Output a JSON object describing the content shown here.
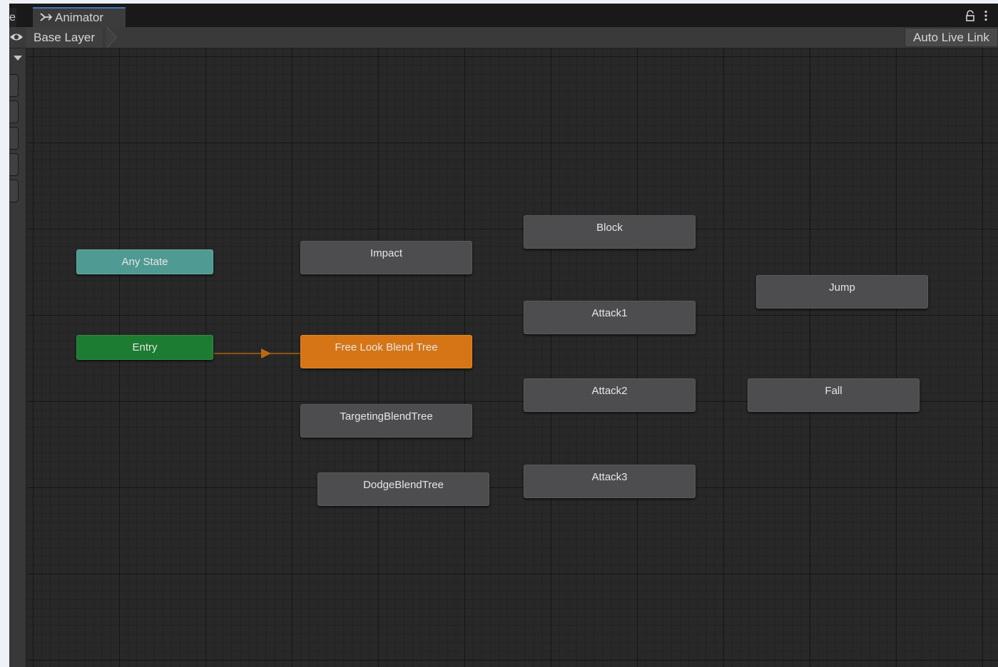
{
  "window": {
    "edge_tab_label": "e",
    "tab_title": "Animator"
  },
  "breadcrumb": {
    "layer": "Base Layer",
    "live_link_label": "Auto Live Link"
  },
  "states": {
    "any_state": "Any State",
    "entry": "Entry",
    "impact": "Impact",
    "free_look": "Free Look Blend Tree",
    "targeting": "TargetingBlendTree",
    "dodge": "DodgeBlendTree",
    "block": "Block",
    "attack1": "Attack1",
    "attack2": "Attack2",
    "attack3": "Attack3",
    "jump": "Jump",
    "fall": "Fall"
  },
  "colors": {
    "any_state": "#4f9a92",
    "entry": "#1c7c31",
    "default_state": "#d57516",
    "state": "#4d4d4f",
    "transition": "#b96a10"
  },
  "icons": {
    "tab": "animator-icon",
    "lock": "lock-icon",
    "menu": "kebab-menu-icon",
    "visibility": "eye-icon"
  }
}
